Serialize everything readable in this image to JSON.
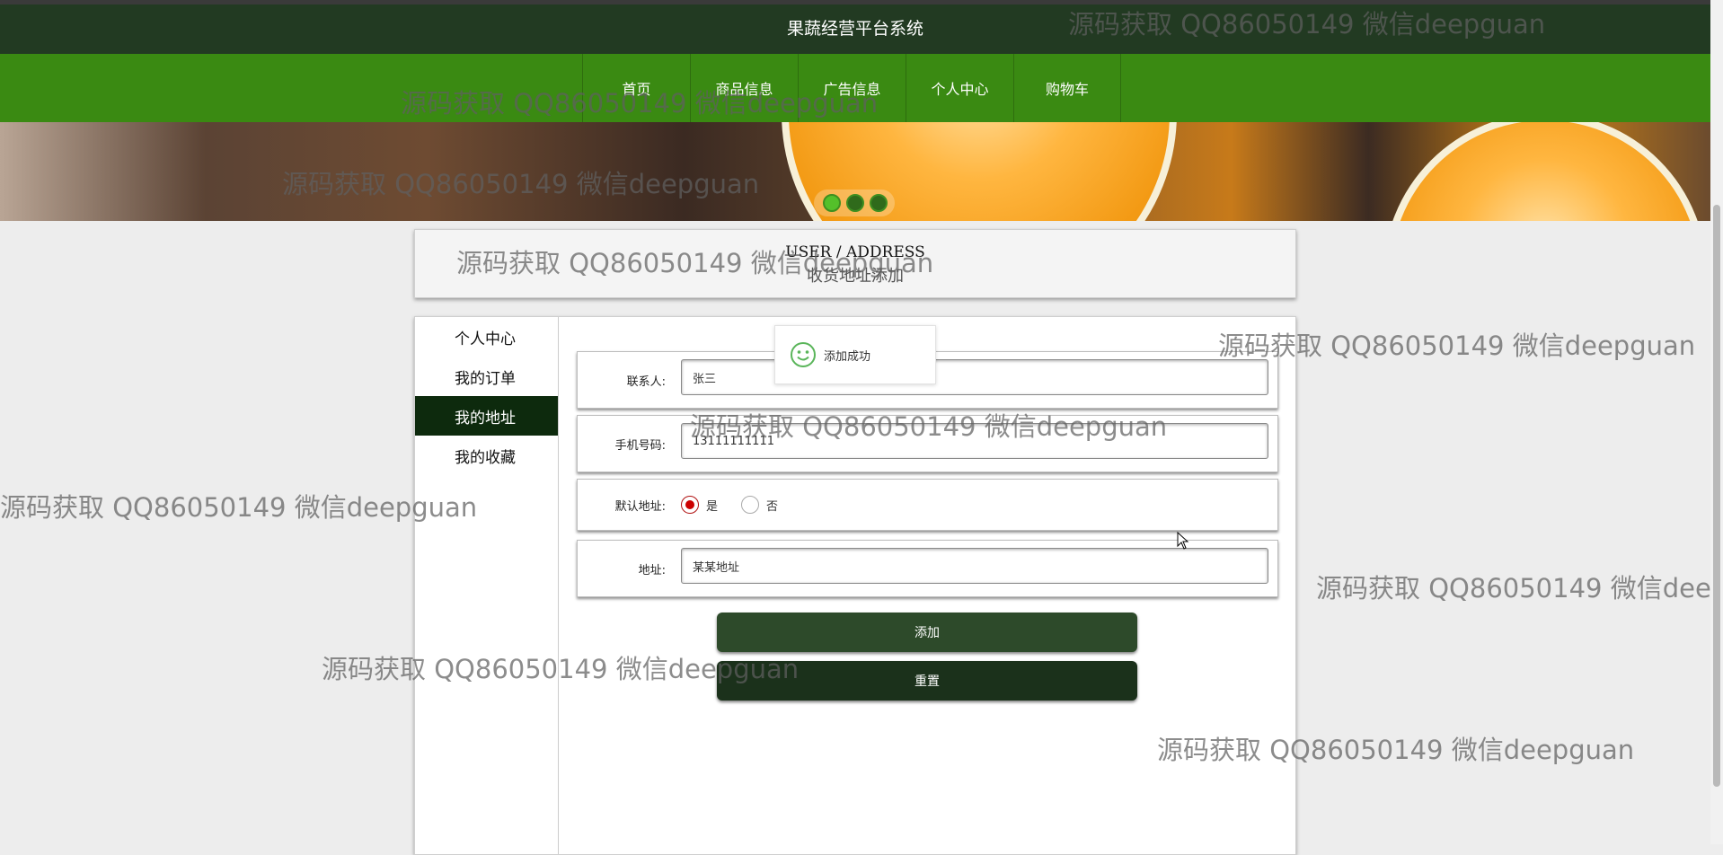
{
  "header": {
    "title": "果蔬经营平台系统"
  },
  "nav": {
    "items": [
      "首页",
      "商品信息",
      "广告信息",
      "个人中心",
      "购物车"
    ]
  },
  "page_heading": {
    "en": "USER / ADDRESS",
    "cn": "收货地址添加"
  },
  "sidebar": {
    "items": [
      {
        "label": "个人中心"
      },
      {
        "label": "我的订单"
      },
      {
        "label": "我的地址",
        "active": true
      },
      {
        "label": "我的收藏"
      }
    ]
  },
  "form": {
    "contact": {
      "label": "联系人:",
      "value": "张三"
    },
    "phone": {
      "label": "手机号码:",
      "value": "13111111111"
    },
    "default": {
      "label": "默认地址:",
      "options": [
        "是",
        "否"
      ],
      "selected": "是"
    },
    "address": {
      "label": "地址:",
      "value": "某某地址"
    },
    "add_button": "添加",
    "reset_button": "重置"
  },
  "toast": {
    "message": "添加成功",
    "icon": "smile-icon"
  },
  "watermark": "源码获取 QQ86050149 微信deepguan",
  "colors": {
    "nav_green": "#3a8a12",
    "topbar": "#223a22",
    "active_side": "#0d2a0d"
  }
}
